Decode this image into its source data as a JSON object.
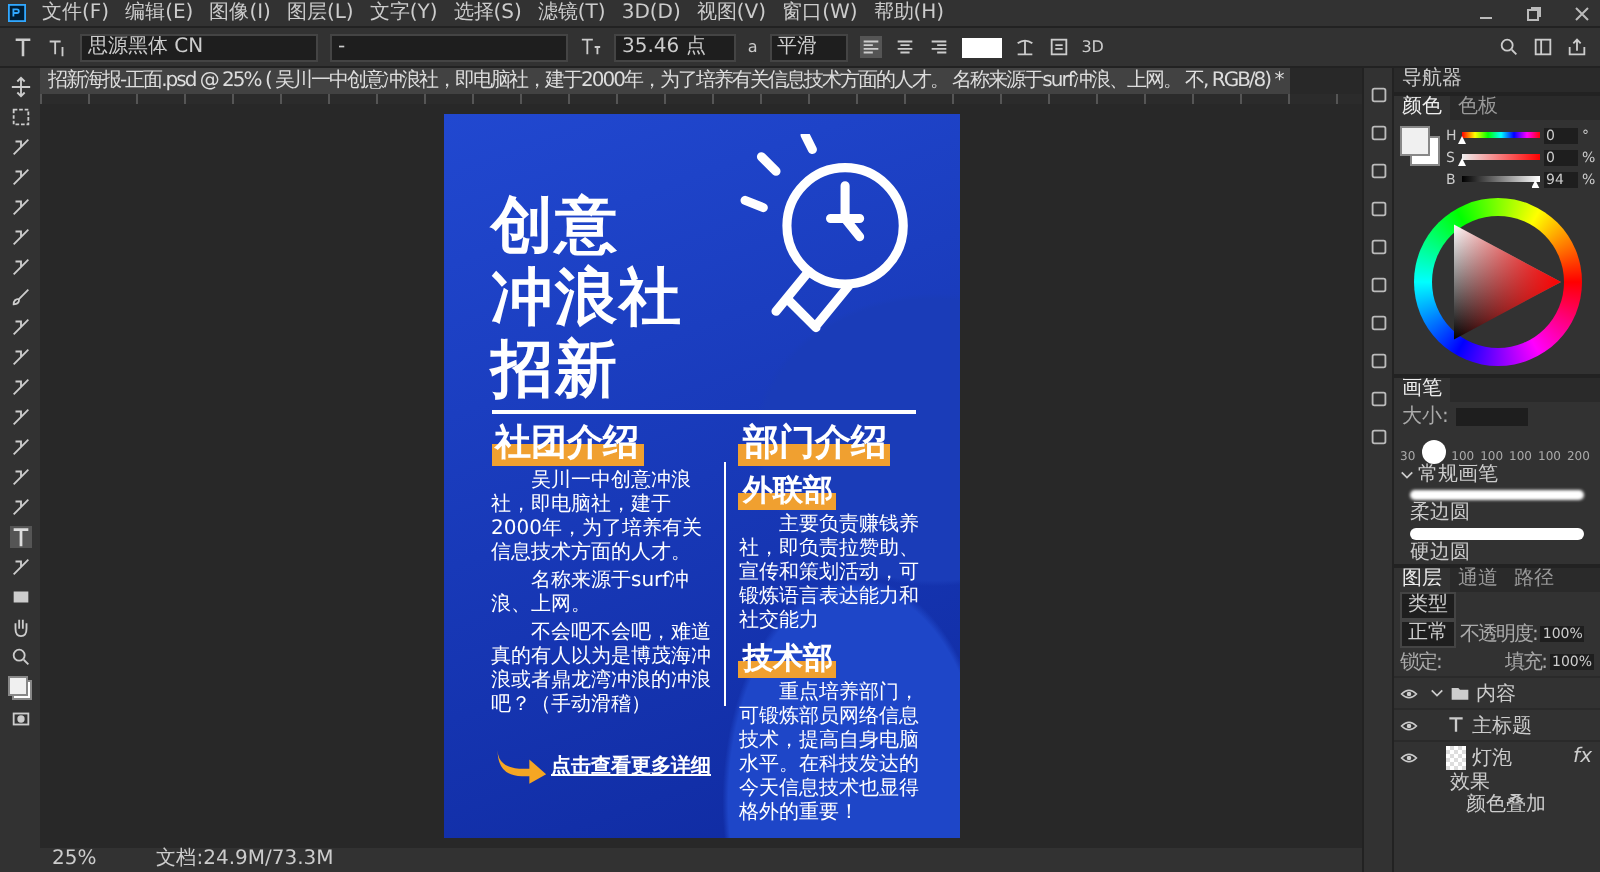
{
  "menu": [
    "文件(F)",
    "编辑(E)",
    "图像(I)",
    "图层(L)",
    "文字(Y)",
    "选择(S)",
    "滤镜(T)",
    "3D(D)",
    "视图(V)",
    "窗口(W)",
    "帮助(H)"
  ],
  "options_bar": {
    "font_family": "思源黑体 CN",
    "font_style": "-",
    "font_size": "35.46 点",
    "anti_alias_glyph": "a",
    "anti_alias": "平滑",
    "mode_3d": "3D",
    "align": [
      {
        "selected": true
      },
      {
        "selected": false
      },
      {
        "selected": false
      }
    ]
  },
  "document_tab": {
    "title": "招新海报-正面.psd @ 25% ( 吴川一中创意冲浪社，即电脑社，建于2000年，为了培养有关信息技术方面的人才。  名称来源于surf冲浪、上网。  不, RGB/8) *"
  },
  "poster": {
    "title_lines": [
      "创意",
      "冲浪社",
      "招新"
    ],
    "club": {
      "heading": "社团介绍",
      "paragraphs": [
        "吴川一中创意冲浪社，即电脑社，建于2000年，为了培养有关信息技术方面的人才。",
        "名称来源于surf冲浪、上网。",
        "不会吧不会吧，难道真的有人以为是博茂海冲浪或者鼎龙湾冲浪的冲浪吧？（手动滑稽）"
      ],
      "link": "点击查看更多详细"
    },
    "departments": {
      "heading": "部门介绍",
      "items": [
        {
          "name": "外联部",
          "text": "主要负责赚钱养社，即负责拉赞助、宣传和策划活动，可锻炼语言表达能力和社交能力"
        },
        {
          "name": "技术部",
          "text": "重点培养部门，可锻炼部员网络信息技术，提高自身电脑水平。在科技发达的今天信息技术也显得格外的重要！"
        }
      ]
    }
  },
  "status_bar": {
    "zoom": "25%",
    "doc_info": "文档:24.9M/73.3M"
  },
  "navigator": {
    "title": "导航器"
  },
  "color_panel": {
    "tabs": [
      {
        "label": "颜色",
        "selected": true
      },
      {
        "label": "色板",
        "selected": false
      }
    ],
    "sliders": [
      {
        "label": "H",
        "kind": "hue",
        "level": 0,
        "value": "0",
        "unit": "°"
      },
      {
        "label": "S",
        "kind": "saturation",
        "level": 0,
        "value": "0",
        "unit": "%"
      },
      {
        "label": "B",
        "kind": "brightness",
        "level": 0.94,
        "value": "94",
        "unit": "%"
      }
    ]
  },
  "brush_panel": {
    "title": "画笔",
    "size_label": "大小:",
    "presets": [
      "30",
      "100",
      "100",
      "100",
      "100",
      "200"
    ],
    "group": {
      "name": "常规画笔",
      "expanded": true,
      "brushes": [
        "柔边圆",
        "硬边圆"
      ]
    }
  },
  "layers_panel": {
    "tabs": [
      {
        "label": "图层",
        "selected": true
      },
      {
        "label": "通道",
        "selected": false
      },
      {
        "label": "路径",
        "selected": false
      }
    ],
    "filter": "类型",
    "blend_mode": "正常",
    "opacity_label": "不透明度:",
    "opacity": "100%",
    "lock_label": "锁定:",
    "fill_label": "填充:",
    "fill": "100%",
    "layers": [
      {
        "name": "内容",
        "kind": "group",
        "visible": true,
        "expanded": true,
        "children": [
          {
            "name": "主标题",
            "kind": "text",
            "visible": true
          },
          {
            "name": "灯泡",
            "kind": "image",
            "visible": true,
            "badge": "fx",
            "effects": {
              "label": "效果",
              "items": [
                "颜色叠加"
              ]
            }
          }
        ]
      }
    ]
  }
}
